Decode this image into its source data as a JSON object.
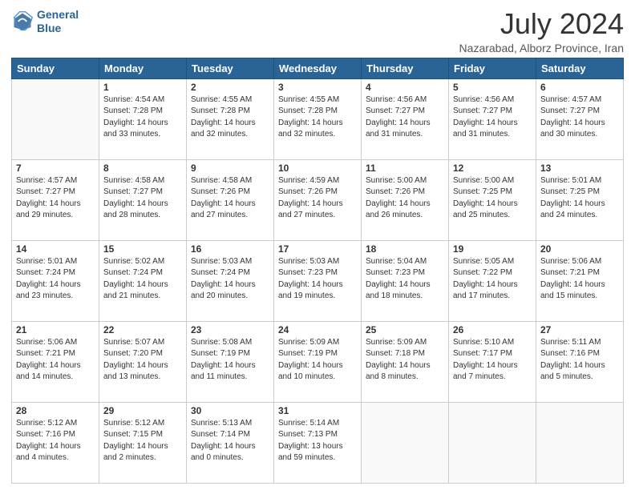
{
  "header": {
    "logo_line1": "General",
    "logo_line2": "Blue",
    "title": "July 2024",
    "subtitle": "Nazarabad, Alborz Province, Iran"
  },
  "calendar": {
    "days": [
      "Sunday",
      "Monday",
      "Tuesday",
      "Wednesday",
      "Thursday",
      "Friday",
      "Saturday"
    ],
    "rows": [
      [
        {
          "day": "",
          "sunrise": "",
          "sunset": "",
          "daylight": ""
        },
        {
          "day": "1",
          "sunrise": "Sunrise: 4:54 AM",
          "sunset": "Sunset: 7:28 PM",
          "daylight": "Daylight: 14 hours and 33 minutes."
        },
        {
          "day": "2",
          "sunrise": "Sunrise: 4:55 AM",
          "sunset": "Sunset: 7:28 PM",
          "daylight": "Daylight: 14 hours and 32 minutes."
        },
        {
          "day": "3",
          "sunrise": "Sunrise: 4:55 AM",
          "sunset": "Sunset: 7:28 PM",
          "daylight": "Daylight: 14 hours and 32 minutes."
        },
        {
          "day": "4",
          "sunrise": "Sunrise: 4:56 AM",
          "sunset": "Sunset: 7:27 PM",
          "daylight": "Daylight: 14 hours and 31 minutes."
        },
        {
          "day": "5",
          "sunrise": "Sunrise: 4:56 AM",
          "sunset": "Sunset: 7:27 PM",
          "daylight": "Daylight: 14 hours and 31 minutes."
        },
        {
          "day": "6",
          "sunrise": "Sunrise: 4:57 AM",
          "sunset": "Sunset: 7:27 PM",
          "daylight": "Daylight: 14 hours and 30 minutes."
        }
      ],
      [
        {
          "day": "7",
          "sunrise": "Sunrise: 4:57 AM",
          "sunset": "Sunset: 7:27 PM",
          "daylight": "Daylight: 14 hours and 29 minutes."
        },
        {
          "day": "8",
          "sunrise": "Sunrise: 4:58 AM",
          "sunset": "Sunset: 7:27 PM",
          "daylight": "Daylight: 14 hours and 28 minutes."
        },
        {
          "day": "9",
          "sunrise": "Sunrise: 4:58 AM",
          "sunset": "Sunset: 7:26 PM",
          "daylight": "Daylight: 14 hours and 27 minutes."
        },
        {
          "day": "10",
          "sunrise": "Sunrise: 4:59 AM",
          "sunset": "Sunset: 7:26 PM",
          "daylight": "Daylight: 14 hours and 27 minutes."
        },
        {
          "day": "11",
          "sunrise": "Sunrise: 5:00 AM",
          "sunset": "Sunset: 7:26 PM",
          "daylight": "Daylight: 14 hours and 26 minutes."
        },
        {
          "day": "12",
          "sunrise": "Sunrise: 5:00 AM",
          "sunset": "Sunset: 7:25 PM",
          "daylight": "Daylight: 14 hours and 25 minutes."
        },
        {
          "day": "13",
          "sunrise": "Sunrise: 5:01 AM",
          "sunset": "Sunset: 7:25 PM",
          "daylight": "Daylight: 14 hours and 24 minutes."
        }
      ],
      [
        {
          "day": "14",
          "sunrise": "Sunrise: 5:01 AM",
          "sunset": "Sunset: 7:24 PM",
          "daylight": "Daylight: 14 hours and 23 minutes."
        },
        {
          "day": "15",
          "sunrise": "Sunrise: 5:02 AM",
          "sunset": "Sunset: 7:24 PM",
          "daylight": "Daylight: 14 hours and 21 minutes."
        },
        {
          "day": "16",
          "sunrise": "Sunrise: 5:03 AM",
          "sunset": "Sunset: 7:24 PM",
          "daylight": "Daylight: 14 hours and 20 minutes."
        },
        {
          "day": "17",
          "sunrise": "Sunrise: 5:03 AM",
          "sunset": "Sunset: 7:23 PM",
          "daylight": "Daylight: 14 hours and 19 minutes."
        },
        {
          "day": "18",
          "sunrise": "Sunrise: 5:04 AM",
          "sunset": "Sunset: 7:23 PM",
          "daylight": "Daylight: 14 hours and 18 minutes."
        },
        {
          "day": "19",
          "sunrise": "Sunrise: 5:05 AM",
          "sunset": "Sunset: 7:22 PM",
          "daylight": "Daylight: 14 hours and 17 minutes."
        },
        {
          "day": "20",
          "sunrise": "Sunrise: 5:06 AM",
          "sunset": "Sunset: 7:21 PM",
          "daylight": "Daylight: 14 hours and 15 minutes."
        }
      ],
      [
        {
          "day": "21",
          "sunrise": "Sunrise: 5:06 AM",
          "sunset": "Sunset: 7:21 PM",
          "daylight": "Daylight: 14 hours and 14 minutes."
        },
        {
          "day": "22",
          "sunrise": "Sunrise: 5:07 AM",
          "sunset": "Sunset: 7:20 PM",
          "daylight": "Daylight: 14 hours and 13 minutes."
        },
        {
          "day": "23",
          "sunrise": "Sunrise: 5:08 AM",
          "sunset": "Sunset: 7:19 PM",
          "daylight": "Daylight: 14 hours and 11 minutes."
        },
        {
          "day": "24",
          "sunrise": "Sunrise: 5:09 AM",
          "sunset": "Sunset: 7:19 PM",
          "daylight": "Daylight: 14 hours and 10 minutes."
        },
        {
          "day": "25",
          "sunrise": "Sunrise: 5:09 AM",
          "sunset": "Sunset: 7:18 PM",
          "daylight": "Daylight: 14 hours and 8 minutes."
        },
        {
          "day": "26",
          "sunrise": "Sunrise: 5:10 AM",
          "sunset": "Sunset: 7:17 PM",
          "daylight": "Daylight: 14 hours and 7 minutes."
        },
        {
          "day": "27",
          "sunrise": "Sunrise: 5:11 AM",
          "sunset": "Sunset: 7:16 PM",
          "daylight": "Daylight: 14 hours and 5 minutes."
        }
      ],
      [
        {
          "day": "28",
          "sunrise": "Sunrise: 5:12 AM",
          "sunset": "Sunset: 7:16 PM",
          "daylight": "Daylight: 14 hours and 4 minutes."
        },
        {
          "day": "29",
          "sunrise": "Sunrise: 5:12 AM",
          "sunset": "Sunset: 7:15 PM",
          "daylight": "Daylight: 14 hours and 2 minutes."
        },
        {
          "day": "30",
          "sunrise": "Sunrise: 5:13 AM",
          "sunset": "Sunset: 7:14 PM",
          "daylight": "Daylight: 14 hours and 0 minutes."
        },
        {
          "day": "31",
          "sunrise": "Sunrise: 5:14 AM",
          "sunset": "Sunset: 7:13 PM",
          "daylight": "Daylight: 13 hours and 59 minutes."
        },
        {
          "day": "",
          "sunrise": "",
          "sunset": "",
          "daylight": ""
        },
        {
          "day": "",
          "sunrise": "",
          "sunset": "",
          "daylight": ""
        },
        {
          "day": "",
          "sunrise": "",
          "sunset": "",
          "daylight": ""
        }
      ]
    ]
  }
}
